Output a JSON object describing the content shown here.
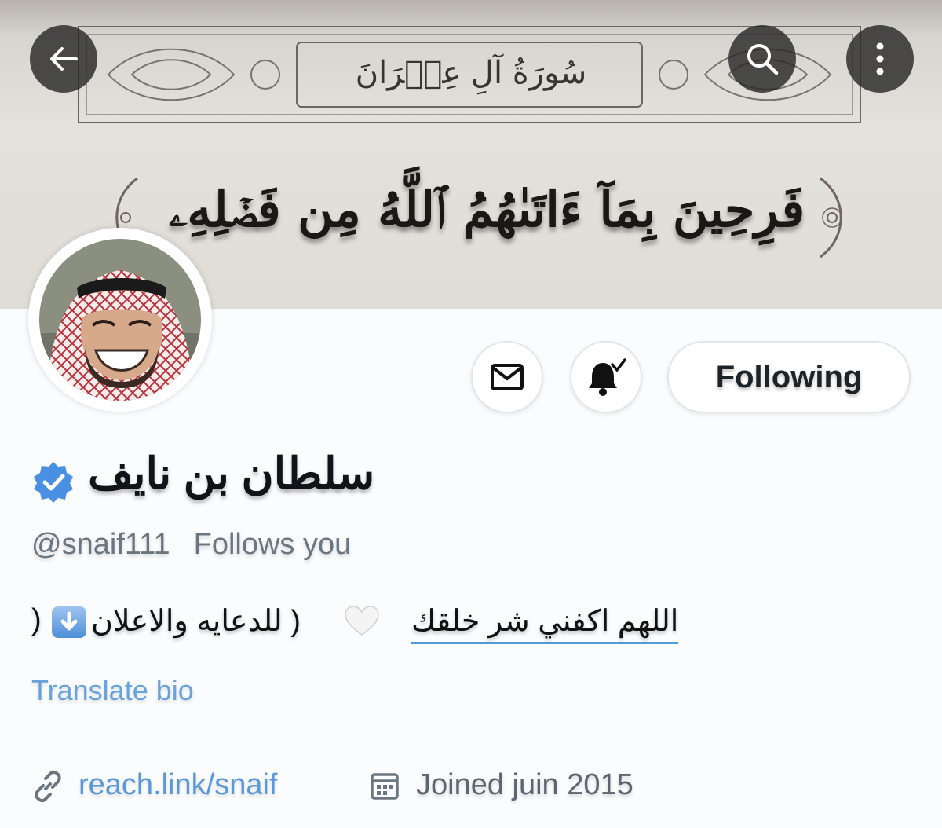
{
  "banner": {
    "surah_title": "سُورَةُ آلِ عِمۡرَانَ",
    "verse": "فَرِحِينَ بِمَآ ءَاتَىٰهُمُ ٱللَّهُ مِن فَضۡلِهِۦ"
  },
  "nav": {
    "back_icon": "arrow-left-icon",
    "search_icon": "search-icon",
    "more_icon": "more-vertical-icon"
  },
  "profile": {
    "display_name": "سلطان بن نايف",
    "handle": "@snaif111",
    "follows_you": "Follows you",
    "bio_prayer": "اللهم اكفني شر خلقك",
    "bio_ad": "( للدعايه والاعلان",
    "bio_close_paren": ")",
    "translate_label": "Translate bio",
    "website": "reach.link/snaif",
    "joined": "Joined juin 2015"
  },
  "actions": {
    "message_icon": "envelope-icon",
    "notify_icon": "bell-icon",
    "following_label": "Following"
  },
  "colors": {
    "accent": "#1d9bf0",
    "link": "#5b98d8",
    "muted": "#6b7680"
  }
}
